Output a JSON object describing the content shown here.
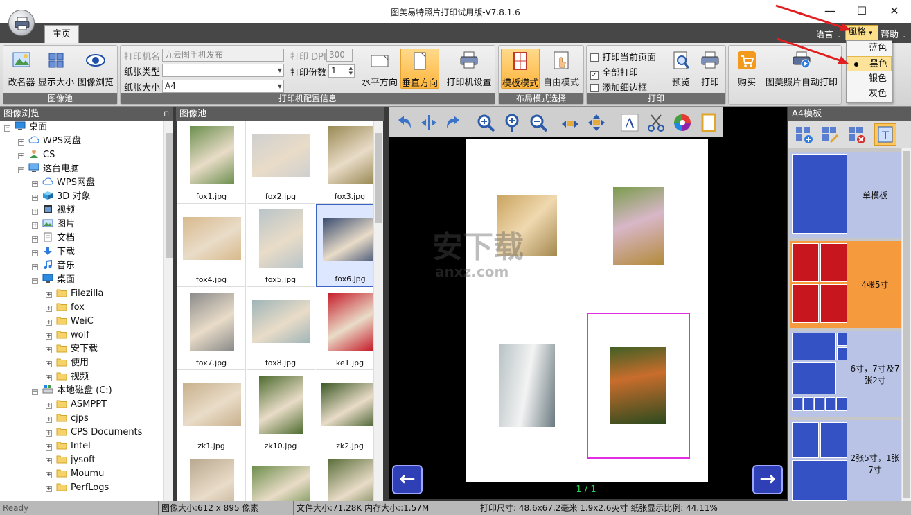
{
  "window": {
    "title": "图美易特照片打印试用版-V7.8.1.6",
    "minimize": "—",
    "maximize": "☐",
    "close": "✕"
  },
  "tabs": {
    "main": "主页"
  },
  "topright": {
    "language": "语言",
    "style": "風格",
    "help": "帮助"
  },
  "style_menu": {
    "items": [
      "蓝色",
      "黑色",
      "银色",
      "灰色"
    ],
    "selected": "黑色"
  },
  "ribbon": {
    "pool_group": {
      "label": "图像池",
      "rename": "改名器",
      "display_size": "显示大小",
      "browse": "图像浏览"
    },
    "printer_group": {
      "label": "打印机配置信息",
      "printer_name_label": "打印机名",
      "printer_name_value": "九云图手机发布",
      "paper_type_label": "纸张类型",
      "paper_type_value": "",
      "paper_size_label": "纸张大小",
      "paper_size_value": "A4",
      "dpi_label": "打印 DPI",
      "dpi_value": "300",
      "copies_label": "打印份数",
      "copies_value": "1",
      "landscape": "水平方向",
      "portrait": "垂直方向",
      "printer_setup": "打印机设置"
    },
    "layout_group": {
      "label": "布局模式选择",
      "template_mode": "模板模式",
      "free_mode": "自由模式"
    },
    "print_group": {
      "label": "打印",
      "print_current": "打印当前页面",
      "print_all": "全部打印",
      "add_border": "添加细边框",
      "preview": "预览",
      "print": "打印"
    },
    "buy_group": {
      "buy": "购买",
      "auto_print": "图美照片自动打印"
    }
  },
  "browser_panel": {
    "title": "图像浏览",
    "tree": [
      {
        "label": "桌面",
        "level": 0,
        "icon": "desktop-icon",
        "exp": "−"
      },
      {
        "label": "WPS网盘",
        "level": 1,
        "icon": "cloud-icon",
        "exp": "+"
      },
      {
        "label": "CS",
        "level": 1,
        "icon": "user-icon",
        "exp": "+"
      },
      {
        "label": "这台电脑",
        "level": 1,
        "icon": "computer-icon",
        "exp": "−"
      },
      {
        "label": "WPS网盘",
        "level": 2,
        "icon": "cloud-icon",
        "exp": "+"
      },
      {
        "label": "3D 对象",
        "level": 2,
        "icon": "cube-icon",
        "exp": "+"
      },
      {
        "label": "视频",
        "level": 2,
        "icon": "video-icon",
        "exp": "+"
      },
      {
        "label": "图片",
        "level": 2,
        "icon": "picture-icon",
        "exp": "+"
      },
      {
        "label": "文档",
        "level": 2,
        "icon": "document-icon",
        "exp": "+"
      },
      {
        "label": "下载",
        "level": 2,
        "icon": "download-icon",
        "exp": "+"
      },
      {
        "label": "音乐",
        "level": 2,
        "icon": "music-icon",
        "exp": "+"
      },
      {
        "label": "桌面",
        "level": 2,
        "icon": "desktop-icon",
        "exp": "−"
      },
      {
        "label": "Filezilla",
        "level": 3,
        "icon": "folder-icon",
        "exp": "+"
      },
      {
        "label": "fox",
        "level": 3,
        "icon": "folder-icon",
        "exp": "+"
      },
      {
        "label": "WeiC",
        "level": 3,
        "icon": "folder-icon",
        "exp": "+"
      },
      {
        "label": "wolf",
        "level": 3,
        "icon": "folder-icon",
        "exp": "+"
      },
      {
        "label": "安下载",
        "level": 3,
        "icon": "folder-icon",
        "exp": "+"
      },
      {
        "label": "使用",
        "level": 3,
        "icon": "folder-icon",
        "exp": "+"
      },
      {
        "label": "视频",
        "level": 3,
        "icon": "folder-icon",
        "exp": "+"
      },
      {
        "label": "本地磁盘 (C:)",
        "level": 2,
        "icon": "drive-icon",
        "exp": "−"
      },
      {
        "label": "ASMPPT",
        "level": 3,
        "icon": "folder-icon",
        "exp": "+"
      },
      {
        "label": "cjps",
        "level": 3,
        "icon": "folder-icon",
        "exp": "+"
      },
      {
        "label": "CPS Documents",
        "level": 3,
        "icon": "folder-icon",
        "exp": "+"
      },
      {
        "label": "Intel",
        "level": 3,
        "icon": "folder-icon",
        "exp": "+"
      },
      {
        "label": "jysoft",
        "level": 3,
        "icon": "folder-icon",
        "exp": "+"
      },
      {
        "label": "Moumu",
        "level": 3,
        "icon": "folder-icon",
        "exp": "+"
      },
      {
        "label": "PerfLogs",
        "level": 3,
        "icon": "folder-icon",
        "exp": "+"
      }
    ]
  },
  "pool_panel": {
    "title": "图像池",
    "images": [
      {
        "name": "fox1.jpg",
        "color": "#6b8f4e"
      },
      {
        "name": "fox2.jpg",
        "color": "#cfcfcf"
      },
      {
        "name": "fox3.jpg",
        "color": "#9a8a55"
      },
      {
        "name": "fox4.jpg",
        "color": "#d8b98c"
      },
      {
        "name": "fox5.jpg",
        "color": "#b9c4c8"
      },
      {
        "name": "fox6.jpg",
        "color": "#3a4d70"
      },
      {
        "name": "fox7.jpg",
        "color": "#8a8a8a"
      },
      {
        "name": "fox8.jpg",
        "color": "#9fb5b8"
      },
      {
        "name": "ke1.jpg",
        "color": "#c61c2a"
      },
      {
        "name": "zk1.jpg",
        "color": "#c8b08c"
      },
      {
        "name": "zk10.jpg",
        "color": "#4d6b2e"
      },
      {
        "name": "zk2.jpg",
        "color": "#3e5a28"
      },
      {
        "name": "",
        "color": "#b9a88f"
      },
      {
        "name": "",
        "color": "#6f8f4d"
      },
      {
        "name": "",
        "color": "#5a6e3a"
      }
    ]
  },
  "canvas": {
    "page": "1 / 1",
    "prev": "←",
    "next": "→",
    "watermark_main": "安下载",
    "watermark_sub": "anxz.com"
  },
  "template_panel": {
    "title": "A4模板",
    "templates": [
      {
        "label": "单模板",
        "highlight": false
      },
      {
        "label": "4张5寸",
        "highlight": true
      },
      {
        "label": "6寸，7寸及7张2寸",
        "highlight": false
      },
      {
        "label": "2张5寸，1张7寸",
        "highlight": false
      }
    ]
  },
  "status": {
    "ready": "Ready",
    "image_size": "图像大小:612 x 895 像素",
    "file_size": "文件大小:71.28K  内存大小::1.57M",
    "print_size": "打印尺寸: 48.6x67.2毫米  1.9x2.6英寸   纸张显示比例: 44.11%"
  }
}
